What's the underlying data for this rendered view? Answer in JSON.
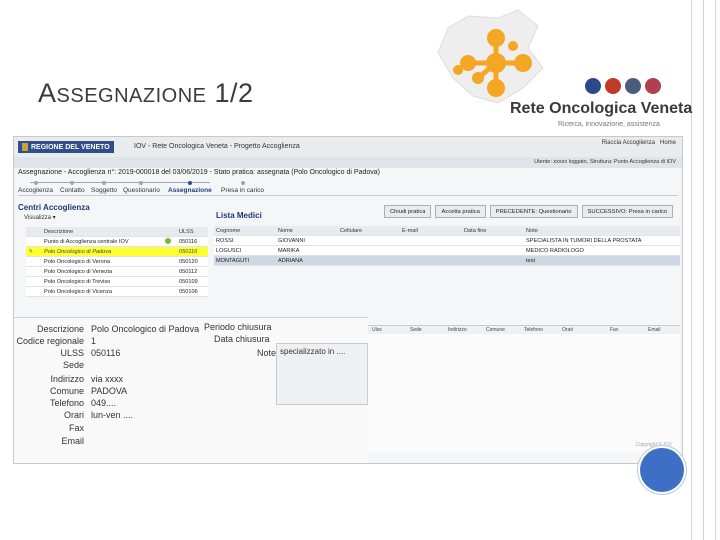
{
  "slide": {
    "title_cap": "A",
    "title_rest": "SSEGNAZIONE",
    "title_num": " 1/2"
  },
  "logo": {
    "name": "Rete Oncologica Veneta",
    "tagline": "Ricerca, innovazione, assistenza",
    "accent": "#f5a623"
  },
  "app": {
    "brand": "REGIONE DEL VENETO",
    "title": "IOV - Rete Oncologica Veneta - Progetto Accoglienza",
    "user_links": [
      "Riaccia Accoglienza",
      "Home"
    ],
    "user_info": "Utente: xxxxx loggato, Struttura: Punto Accoglienza di IOV",
    "practice_header": "Assegnazione - Accoglienza n°: 2019-000018 del 03/06/2019 - Stato pratica: assegnata (Polo Oncologico di Padova)",
    "steps": [
      "Accoglienza",
      "Contatto",
      "Soggetto",
      "Questionario",
      "Assegnazione",
      "Presa in carico"
    ],
    "active_step": "Assegnazione",
    "centri": {
      "title": "Centri Accoglienza",
      "view_menu": "Visualizza",
      "columns": [
        "Descrizione",
        "ULSS"
      ],
      "rows": [
        {
          "name": "Punto di Accoglienza centrale IOV",
          "ulss": "050116",
          "selected": false,
          "ok": true
        },
        {
          "name": "Polo Oncologico di Padova",
          "ulss": "050116",
          "selected": true,
          "ok": false
        },
        {
          "name": "Polo Oncologico di Verona",
          "ulss": "050120",
          "selected": false,
          "ok": false
        },
        {
          "name": "Polo Oncologico di Venezia",
          "ulss": "050112",
          "selected": false,
          "ok": false
        },
        {
          "name": "Polo Oncologico di Treviso",
          "ulss": "050109",
          "selected": false,
          "ok": false
        },
        {
          "name": "Polo Oncologico di Vicenza",
          "ulss": "050106",
          "selected": false,
          "ok": false
        }
      ]
    },
    "buttons": [
      "Chiudi pratica",
      "Accetta pratica",
      "PRECEDENTE: Questionario",
      "SUCCESSIVO: Presa in carico"
    ],
    "medici": {
      "title": "Lista Medici",
      "columns": [
        "Cognome",
        "Nome",
        "Cellulare",
        "E-mail",
        "Data fine",
        "Note"
      ],
      "rows": [
        {
          "cognome": "ROSSI",
          "nome": "GIOVANNI",
          "cell": "",
          "email": "",
          "fine": "",
          "note": "SPECIALISTA IN TUMORI DELLA PROSTATA",
          "selected": false
        },
        {
          "cognome": "LOGUSCI",
          "nome": "MARIKA",
          "cell": "",
          "email": "",
          "fine": "",
          "note": "MEDICO RADIOLOGO",
          "selected": false
        },
        {
          "cognome": "MONTAGUTI",
          "nome": "ADRIANA",
          "cell": "",
          "email": "",
          "fine": "",
          "note": "test",
          "selected": true
        }
      ]
    },
    "bottom_columns": [
      "Ulss",
      "Sede",
      "Indirizzo",
      "Comune",
      "Telefono",
      "Orari",
      "Fax",
      "Email"
    ],
    "copyright": "Copyright © IOV",
    "detail": {
      "descrizione_label": "Descrizione",
      "descrizione": "Polo Oncologico di Padova",
      "codice_label": "Codice regionale",
      "codice": "1",
      "ulss_label": "ULSS",
      "ulss": "050116",
      "sede_label": "Sede",
      "sede": "",
      "indirizzo_label": "Indirizzo",
      "indirizzo": "via xxxx",
      "comune_label": "Comune",
      "comune": "PADOVA",
      "telefono_label": "Telefono",
      "telefono": "049....",
      "orari_label": "Orari",
      "orari": "lun-ven ....",
      "fax_label": "Fax",
      "email_label": "Email",
      "periodo_label": "Periodo chiusura",
      "data_label": "Data chiusura",
      "note_label": "Note",
      "note": "specializzato in ...."
    }
  }
}
